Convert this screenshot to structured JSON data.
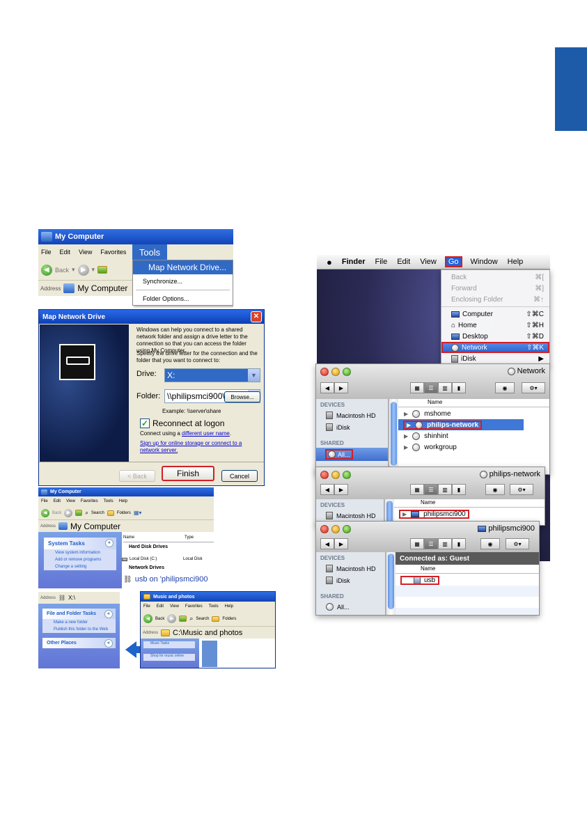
{
  "xp1": {
    "title": "My Computer",
    "menu": [
      "File",
      "Edit",
      "View",
      "Favorites"
    ],
    "tools": "Tools",
    "toolbar_back": "Back",
    "address_label": "Address",
    "address_value": "My Computer",
    "tools_menu": {
      "highlighted": "Map Network Drive...",
      "items": [
        "Synchronize...",
        "Folder Options..."
      ]
    }
  },
  "dialog": {
    "title": "Map Network Drive",
    "intro": "Windows can help you connect to a shared network folder and assign a drive letter to the connection so that you can access the folder using My Computer.",
    "instruction": "Specify the drive letter for the connection and the folder that you want to connect to:",
    "drive_label": "Drive:",
    "drive_value": "X:",
    "folder_label": "Folder:",
    "folder_value": "\\\\philipsmci900\\usb",
    "browse": "Browse...",
    "example": "Example: \\\\server\\share",
    "reconnect": "Reconnect at logon",
    "connect_prefix": "Connect using a ",
    "connect_link": "different user name",
    "connect_suffix": ".",
    "signup_link": "Sign up for online storage or connect to a network server.",
    "back": "< Back",
    "finish": "Finish",
    "cancel": "Cancel"
  },
  "xp2": {
    "title": "My Computer",
    "menu": [
      "File",
      "Edit",
      "View",
      "Favorites",
      "Tools",
      "Help"
    ],
    "back": "Back",
    "search": "Search",
    "folders": "Folders",
    "address_label": "Address",
    "address_value": "My Computer",
    "system_tasks": {
      "title": "System Tasks",
      "items": [
        "View system information",
        "Add or remove programs",
        "Change a setting"
      ]
    },
    "col_name": "Name",
    "col_type": "Type",
    "hard_disk_drives": "Hard Disk Drives",
    "local_disk": "Local Disk (C:)",
    "local_disk_type": "Local Disk",
    "network_drives": "Network Drives",
    "usb_entry": "usb on 'philipsmci900"
  },
  "xp3": {
    "address_label": "Address",
    "address_value": "X:\\",
    "file_folder_tasks": {
      "title": "File and Folder Tasks",
      "items": [
        "Make a new folder",
        "Publish this folder to the Web"
      ]
    },
    "other_places": "Other Places",
    "music_window": {
      "title": "Music and photos",
      "menu": [
        "File",
        "Edit",
        "View",
        "Favorites",
        "Tools",
        "Help"
      ],
      "back": "Back",
      "search": "Search",
      "folders": "Folders",
      "address_label": "Address",
      "address_value": "C:\\Music and photos",
      "tasks": [
        "Music Tasks",
        "Shop for music online"
      ]
    }
  },
  "mac_menubar": {
    "apple": "",
    "items": [
      "Finder",
      "File",
      "Edit",
      "View"
    ],
    "go": "Go",
    "after": [
      "Window",
      "Help"
    ]
  },
  "go_menu": {
    "dim": [
      {
        "label": "Back",
        "shortcut": "⌘["
      },
      {
        "label": "Forward",
        "shortcut": "⌘]"
      },
      {
        "label": "Enclosing Folder",
        "shortcut": "⌘↑"
      }
    ],
    "places": [
      {
        "label": "Computer",
        "shortcut": "⇧⌘C"
      },
      {
        "label": "Home",
        "shortcut": "⇧⌘H"
      },
      {
        "label": "Desktop",
        "shortcut": "⇧⌘D"
      },
      {
        "label": "Network",
        "shortcut": "⇧⌘K"
      },
      {
        "label": "iDisk",
        "shortcut": "▶"
      }
    ]
  },
  "finder1": {
    "title": "Network",
    "devices": "DEVICES",
    "device_items": [
      "Macintosh HD",
      "iDisk"
    ],
    "shared": "SHARED",
    "shared_items": [
      "All..."
    ],
    "name_col": "Name",
    "rows": [
      "mshome",
      "philips-network",
      "shinhint",
      "workgroup"
    ]
  },
  "finder2": {
    "title": "philips-network",
    "devices": "DEVICES",
    "device_items": [
      "Macintosh HD"
    ],
    "name_col": "Name",
    "rows": [
      "philipsmci900"
    ]
  },
  "finder3": {
    "title": "philipsmci900",
    "devices": "DEVICES",
    "device_items": [
      "Macintosh HD",
      "iDisk"
    ],
    "shared": "SHARED",
    "shared_items": [
      "All..."
    ],
    "connected": "Connected as: Guest",
    "name_col": "Name",
    "rows": [
      "usb"
    ]
  },
  "colors": {
    "xp_blue": "#1244b8",
    "mac_highlight": "#2a62cf",
    "annotation_red": "#d21f26",
    "tab_marker": "#1d5ba8"
  }
}
